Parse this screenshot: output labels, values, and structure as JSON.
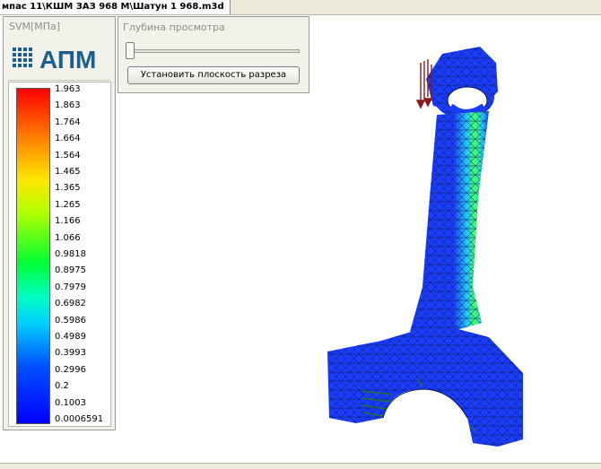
{
  "document_tab": {
    "title": "мпас 11\\КШМ ЗАЗ 968 М\\Шатун 1 968.m3d"
  },
  "legend": {
    "title": "SVM[МПа]",
    "logo_text": "АПМ",
    "ticks": [
      "1.963",
      "1.863",
      "1.764",
      "1.664",
      "1.564",
      "1.465",
      "1.365",
      "1.265",
      "1.166",
      "1.066",
      "0.9818",
      "0.8975",
      "0.7979",
      "0.6982",
      "0.5986",
      "0.4989",
      "0.3993",
      "0.2996",
      "0.2",
      "0.1003",
      "0.0006591"
    ]
  },
  "depth_panel": {
    "title": "Глубина просмотра",
    "slider_value": 0,
    "button_label": "Установить плоскость разреза"
  },
  "colors": {
    "max": "#ff0000",
    "min": "#0000ff",
    "model_base": "#1a3cff",
    "mesh": "#0a1a55"
  }
}
